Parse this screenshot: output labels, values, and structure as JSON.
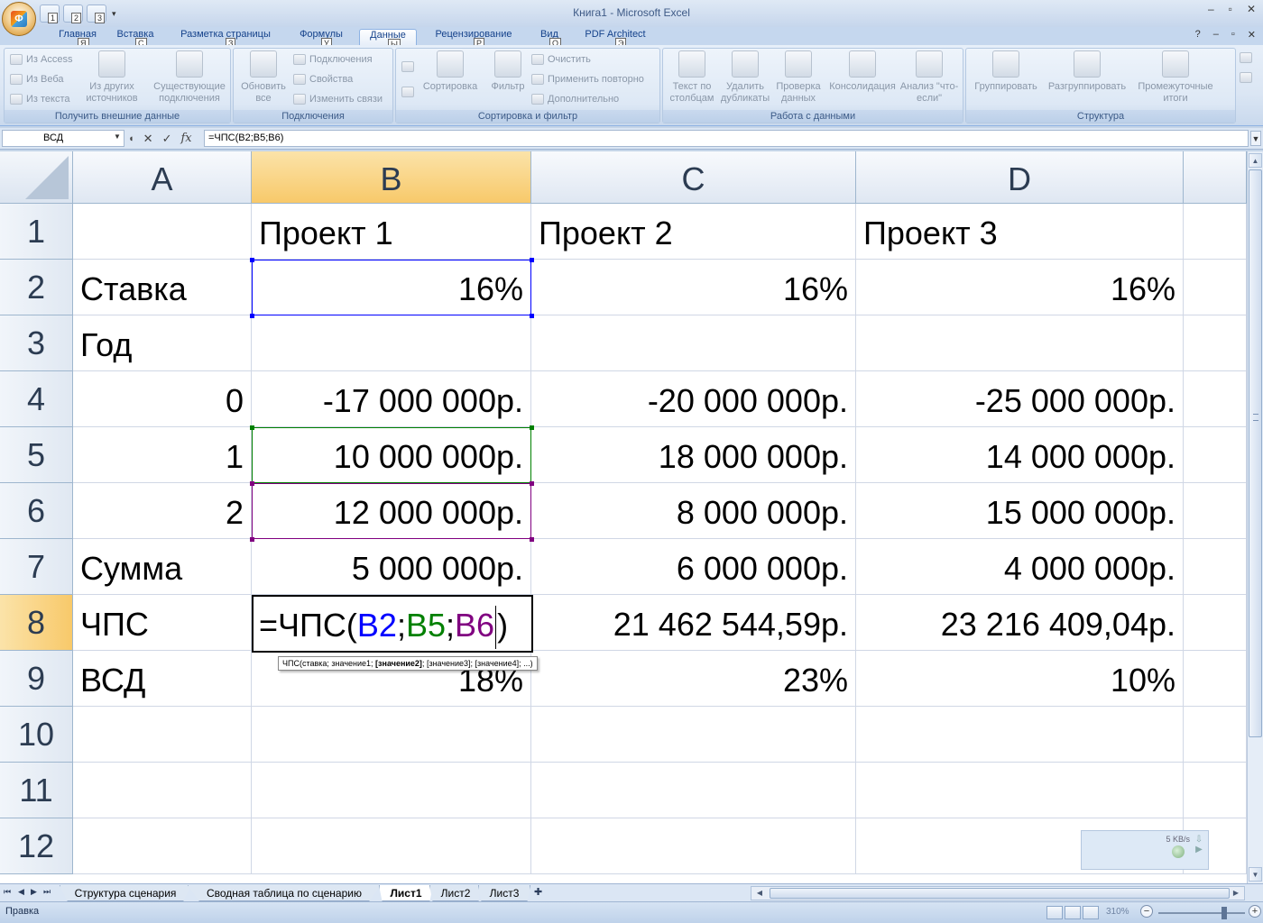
{
  "app": {
    "window_title": "Книга1 - Microsoft Excel",
    "office_button_keytip": "Ф",
    "qat_keytips": [
      "1",
      "2",
      "3"
    ]
  },
  "ribbon": {
    "tabs": [
      {
        "label": "Главная",
        "keytip": "Я"
      },
      {
        "label": "Вставка",
        "keytip": "С"
      },
      {
        "label": "Разметка страницы",
        "keytip": "З"
      },
      {
        "label": "Формулы",
        "keytip": "У"
      },
      {
        "label": "Данные",
        "keytip": "Ы",
        "active": true
      },
      {
        "label": "Рецензирование",
        "keytip": "Р"
      },
      {
        "label": "Вид",
        "keytip": "О"
      },
      {
        "label": "PDF Architect",
        "keytip": "Э"
      }
    ],
    "groups": {
      "external": {
        "label": "Получить внешние данные",
        "from_access": "Из Access",
        "from_web": "Из Веба",
        "from_text": "Из текста",
        "from_other": "Из других источников",
        "existing": "Существующие подключения"
      },
      "connections": {
        "label": "Подключения",
        "refresh_all": "Обновить все",
        "connections": "Подключения",
        "properties": "Свойства",
        "edit_links": "Изменить связи"
      },
      "sort_filter": {
        "label": "Сортировка и фильтр",
        "sort": "Сортировка",
        "filter": "Фильтр",
        "clear": "Очистить",
        "reapply": "Применить повторно",
        "advanced": "Дополнительно"
      },
      "data_tools": {
        "label": "Работа с данными",
        "text_to_columns": "Текст по столбцам",
        "remove_duplicates": "Удалить дубликаты",
        "data_validation": "Проверка данных",
        "consolidate": "Консолидация",
        "what_if": "Анализ \"что-если\""
      },
      "outline": {
        "label": "Структура",
        "group": "Группировать",
        "ungroup": "Разгруппировать",
        "subtotal": "Промежуточные итоги"
      }
    }
  },
  "formula_bar": {
    "name_box": "ВСД",
    "fx_label": "fx",
    "formula": "=ЧПС(B2;B5;B6)"
  },
  "sheet": {
    "columns": [
      "A",
      "B",
      "C",
      "D"
    ],
    "rows": [
      "1",
      "2",
      "3",
      "4",
      "5",
      "6",
      "7",
      "8",
      "9",
      "10",
      "11",
      "12"
    ],
    "cells": {
      "A2": "Ставка",
      "A3": "Год",
      "A4": "0",
      "A5": "1",
      "A6": "2",
      "A7": "Сумма",
      "A8": "ЧПС",
      "A9": "ВСД",
      "B1": "Проект 1",
      "B2": "16%",
      "B4": "-17 000 000р.",
      "B5": "10 000 000р.",
      "B6": "12 000 000р.",
      "B7": "5 000 000р.",
      "B9": "18%",
      "C1": "Проект 2",
      "C2": "16%",
      "C4": "-20 000 000р.",
      "C5": "18 000 000р.",
      "C6": "8 000 000р.",
      "C7": "6 000 000р.",
      "C8": "21 462 544,59р.",
      "C9": "23%",
      "D1": "Проект 3",
      "D2": "16%",
      "D4": "-25 000 000р.",
      "D5": "14 000 000р.",
      "D6": "15 000 000р.",
      "D7": "4 000 000р.",
      "D8": "23 216 409,04р.",
      "D9": "10%"
    },
    "edit_cell": {
      "prefix": "=ЧПС(",
      "ref1": "B2",
      "sep1": ";",
      "ref2": "B5",
      "sep2": ";",
      "ref3": "B6",
      "suffix": ")"
    },
    "tooltip": {
      "start": "ЧПС(ставка; значение1; ",
      "bold": "[значение2]",
      "end": "; [значение3]; [значение4]; ...)"
    },
    "ref_colors": {
      "B2": "#0000ff",
      "B5": "#008000",
      "B6": "#800080"
    }
  },
  "net_widget": {
    "rate": "5 KB/s"
  },
  "sheet_tabs": [
    {
      "label": "Структура сценария"
    },
    {
      "label": "Сводная таблица по сценарию"
    },
    {
      "label": "Лист1",
      "active": true
    },
    {
      "label": "Лист2"
    },
    {
      "label": "Лист3"
    }
  ],
  "status": {
    "mode": "Правка",
    "zoom": "310%"
  }
}
